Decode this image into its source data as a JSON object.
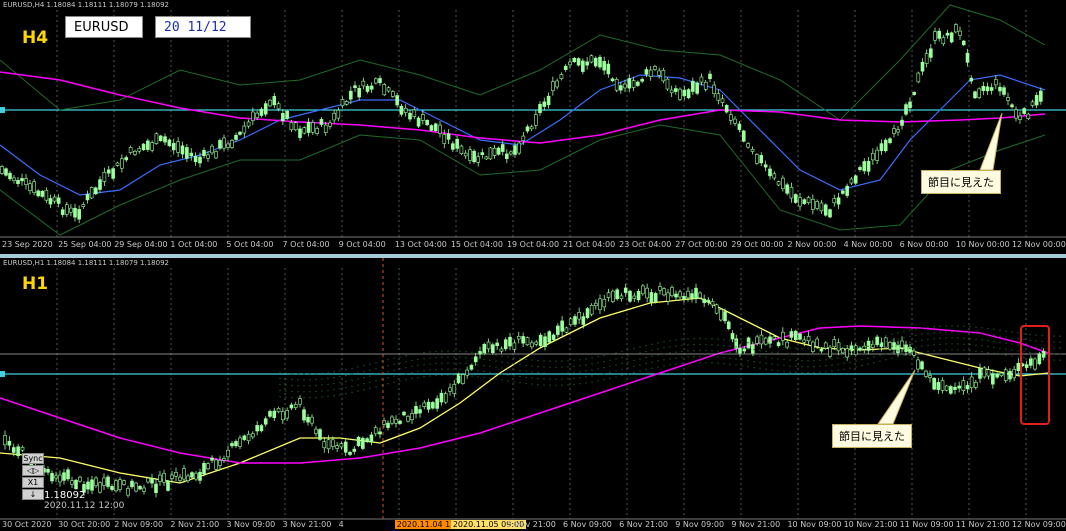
{
  "h4": {
    "header": "EURUSD,H4  1.18084 1.18111 1.18079 1.18092",
    "timeframe": "H4",
    "symbol": "EURUSD",
    "date_box": "20 11/12",
    "callout": "節目に見えた",
    "x_labels": [
      "23 Sep 2020",
      "25 Sep 04:00",
      "29 Sep 04:00",
      "1 Oct 04:00",
      "5 Oct 04:00",
      "7 Oct 04:00",
      "9 Oct 04:00",
      "13 Oct 04:00",
      "15 Oct 04:00",
      "19 Oct 04:00",
      "21 Oct 04:00",
      "23 Oct 04:00",
      "27 Oct 00:00",
      "29 Oct 00:00",
      "2 Nov 00:00",
      "4 Nov 00:00",
      "6 Nov 00:00",
      "10 Nov 00:00",
      "12 Nov 00:00"
    ]
  },
  "h1": {
    "header": "EURUSD,H1  1.18084 1.18111 1.18079 1.18092",
    "timeframe": "H1",
    "callout": "節目に見えた",
    "price": "1.18092",
    "datetime": "2020.11.12 12:00",
    "x_labels": [
      "30 Oct 2020",
      "30 Oct 20:00",
      "2 Nov 09:00",
      "2 Nov 21:00",
      "3 Nov 09:00",
      "3 Nov 21:00",
      "4",
      "2020.11.04 17:00",
      "2020.11.05 09:00",
      "5 Nov 21:00",
      "6 Nov 09:00",
      "6 Nov 21:00",
      "9 Nov 09:00",
      "9 Nov 21:00",
      "10 Nov 09:00",
      "10 Nov 21:00",
      "11 Nov 09:00",
      "11 Nov 21:00",
      "12 Nov 09:00"
    ],
    "controls": [
      "Sync",
      "◁▷",
      "X1",
      "↓"
    ]
  },
  "colors": {
    "ma_slow": "#ff00ff",
    "ma_fast_h4": "#3a6dff",
    "ma_fast_h1": "#ffff66",
    "level_line": "#40d0e0",
    "bollinger": "#1f6b2a",
    "candle": "#9dff9d"
  }
}
